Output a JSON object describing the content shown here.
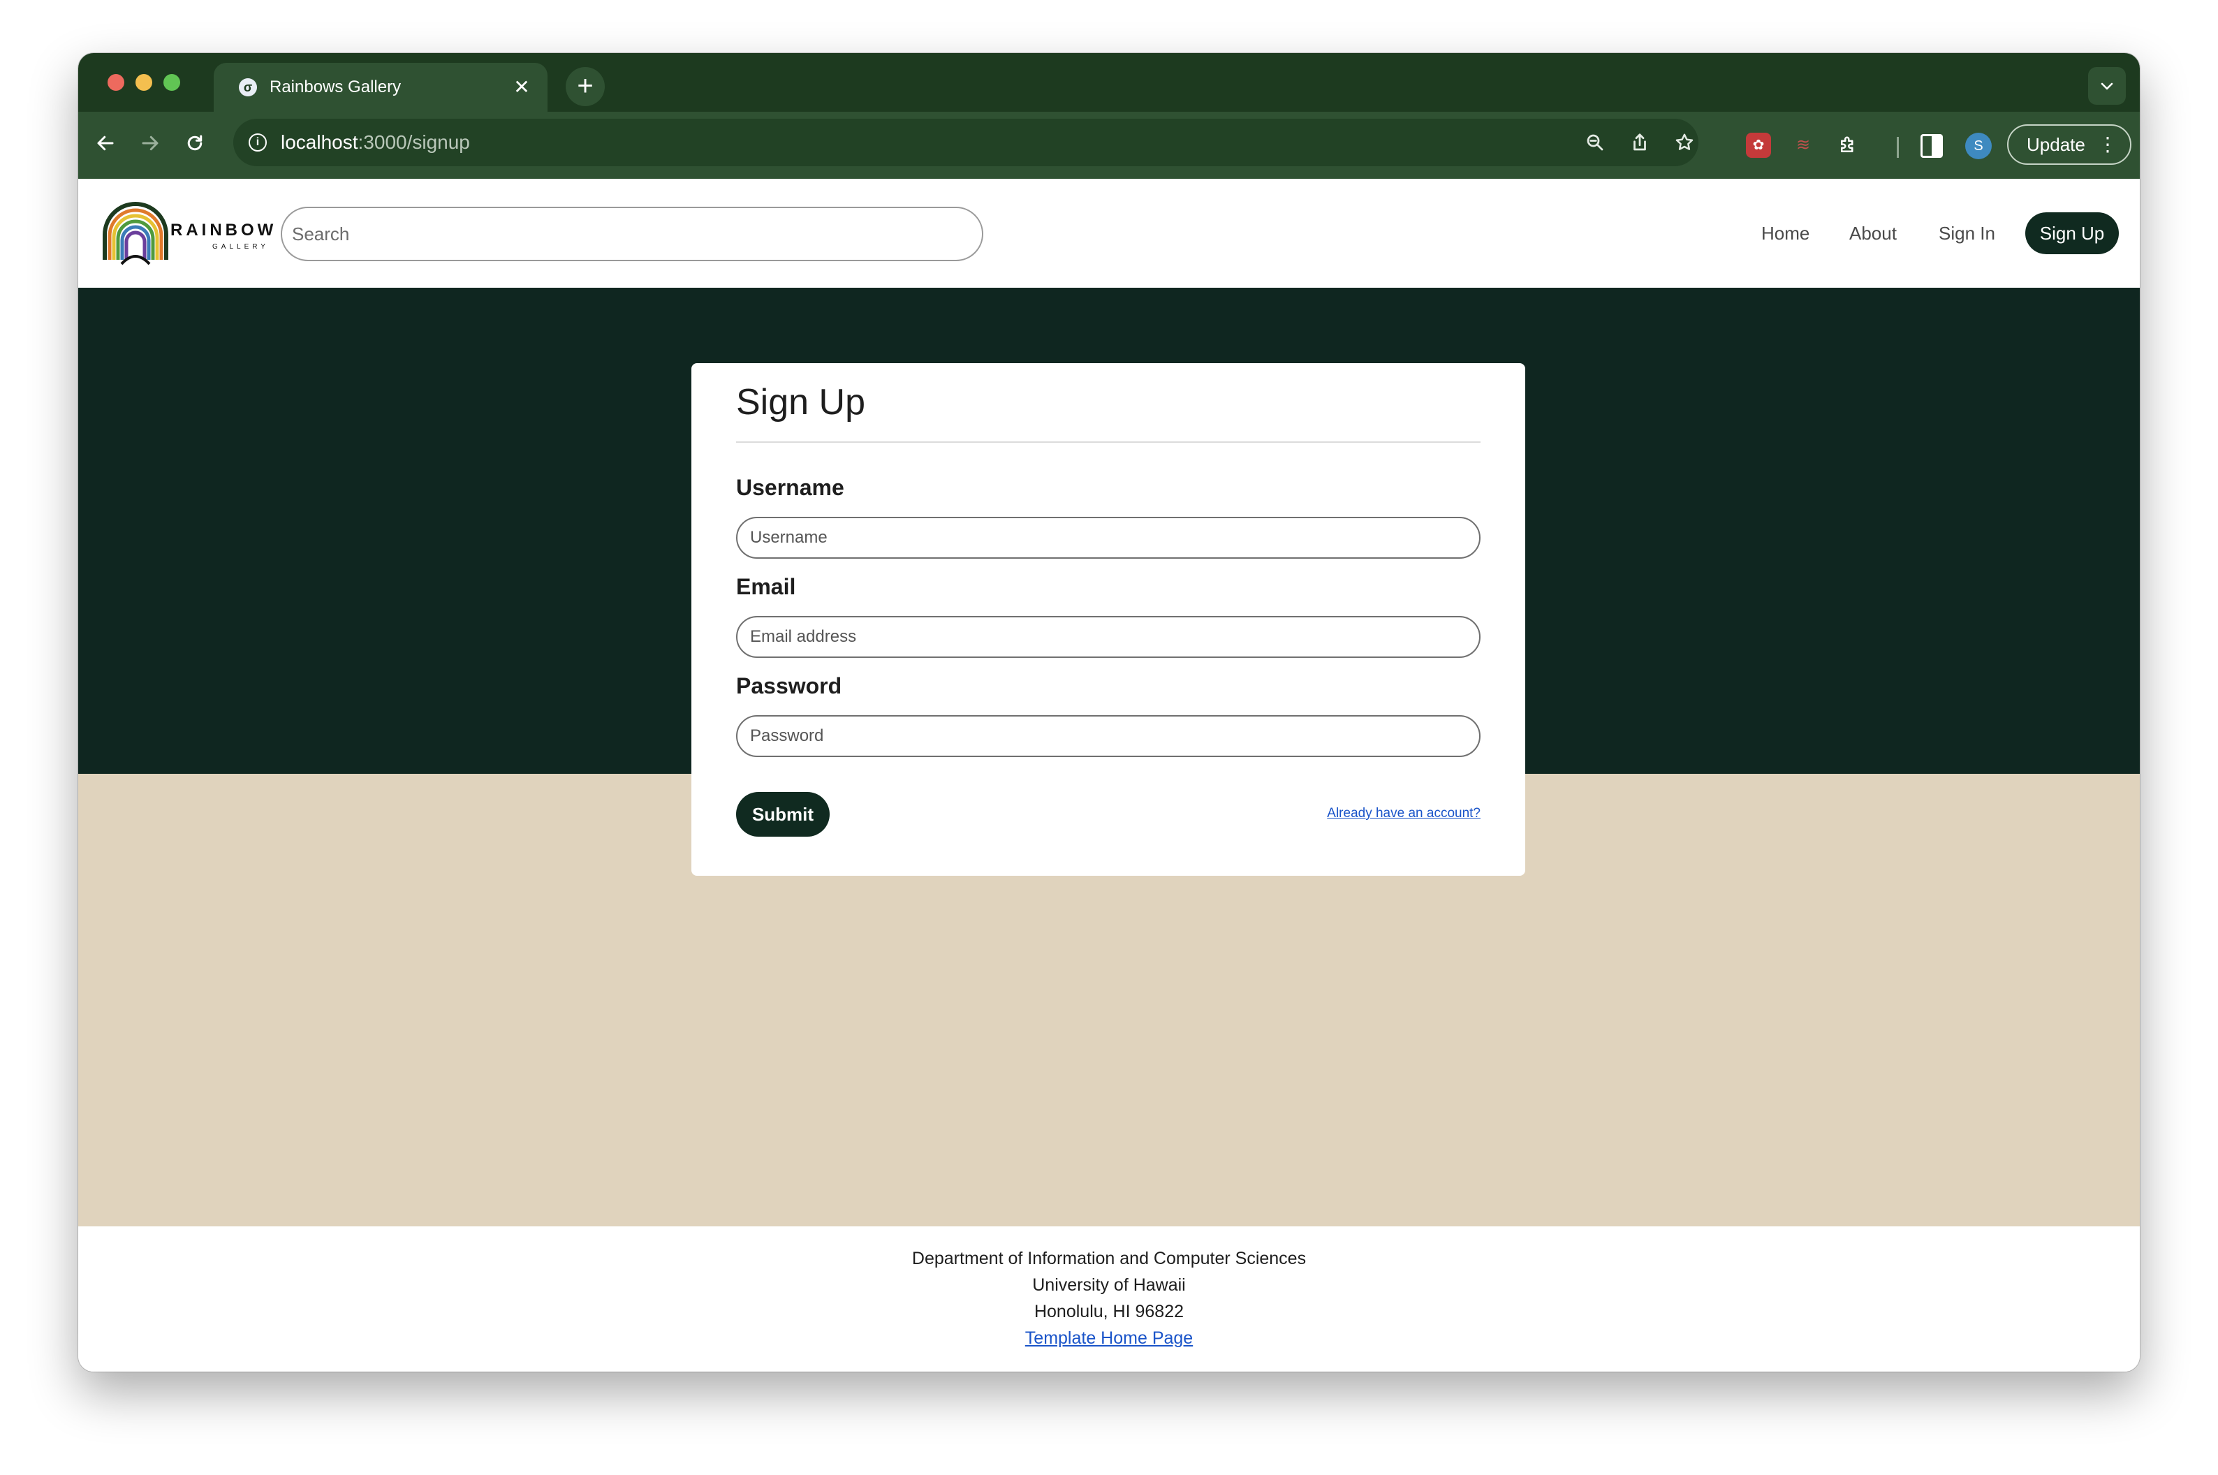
{
  "browser": {
    "tab_title": "Rainbows Gallery",
    "new_tab_symbol": "+",
    "close_symbol": "✕",
    "url_host": "localhost",
    "url_path": ":3000/signup",
    "update_label": "Update",
    "profile_initial": "S",
    "icons": [
      "back-arrow-icon",
      "forward-arrow-icon",
      "reload-icon",
      "site-info-icon",
      "zoom-icon",
      "share-icon",
      "bookmark-star-icon",
      "extension-icon",
      "puzzle-icon",
      "side-panel-icon",
      "kebab-menu-icon",
      "tab-list-chevron-icon"
    ]
  },
  "site_nav": {
    "logo_text": "RAINBOW",
    "logo_sub": "GALLERY",
    "search_placeholder": "Search",
    "links": {
      "home": "Home",
      "about": "About",
      "sign_in": "Sign In",
      "sign_up": "Sign Up"
    }
  },
  "form": {
    "title": "Sign Up",
    "username_label": "Username",
    "username_placeholder": "Username",
    "email_label": "Email",
    "email_placeholder": "Email address",
    "password_label": "Password",
    "password_placeholder": "Password",
    "submit_label": "Submit",
    "already_link": "Already have an account?"
  },
  "footer": {
    "line1": "Department of Information and Computer Sciences",
    "line2": "University of Hawaii",
    "line3": "Honolulu, HI 96822",
    "link": "Template Home Page"
  },
  "colors": {
    "browser_frame": "#1d3a1f",
    "browser_toolbar": "#2f5132",
    "hero_dark": "#0f2620",
    "hero_tan": "#e0d3bd",
    "primary_button": "#102a20",
    "link": "#1a54c9"
  }
}
